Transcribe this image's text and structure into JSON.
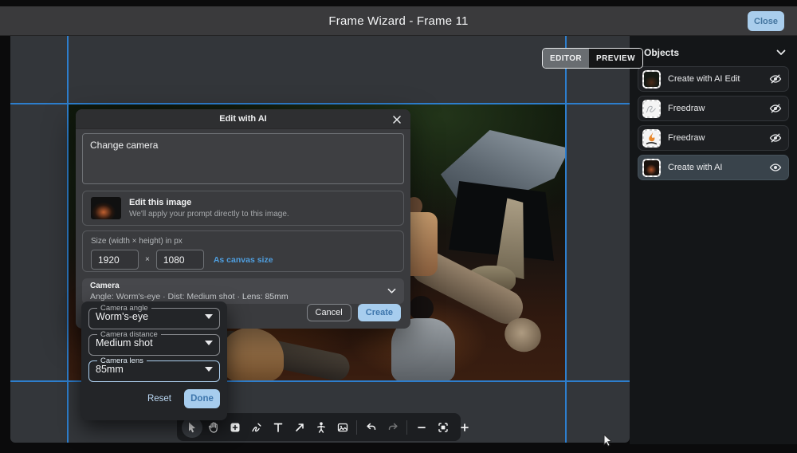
{
  "window": {
    "title": "Frame Wizard - Frame 11",
    "close_label": "Close"
  },
  "view_toggle": {
    "editor": "EDITOR",
    "preview": "PREVIEW"
  },
  "objects_panel": {
    "title": "Objects",
    "items": [
      {
        "label": "Create with AI Edit",
        "visible": false,
        "thumb": "dark-photo"
      },
      {
        "label": "Freedraw",
        "visible": false,
        "thumb": "gray-scribble"
      },
      {
        "label": "Freedraw",
        "visible": false,
        "thumb": "flame-sketch"
      },
      {
        "label": "Create with AI",
        "visible": true,
        "selected": true,
        "thumb": "dark-photo-fire"
      }
    ]
  },
  "modal": {
    "title": "Edit with AI",
    "prompt_value": "Change camera",
    "edit_target": {
      "title": "Edit this image",
      "description": "We'll apply your prompt directly to this image."
    },
    "size": {
      "label": "Size (width × height) in px",
      "width_value": "1920",
      "times": "×",
      "height_value": "1080",
      "canvas_link": "As canvas size"
    },
    "camera_summary": {
      "title": "Camera",
      "subtitle": "Angle: Worm's-eye · Dist: Medium shot · Lens: 85mm"
    },
    "cancel_label": "Cancel",
    "create_label": "Create"
  },
  "camera_popover": {
    "fields": [
      {
        "label": "Camera angle",
        "value": "Worm's-eye",
        "focused": false
      },
      {
        "label": "Camera distance",
        "value": "Medium shot",
        "focused": false
      },
      {
        "label": "Camera lens",
        "value": "85mm",
        "focused": true
      }
    ],
    "reset_label": "Reset",
    "done_label": "Done"
  },
  "toolbar": {
    "tools": [
      "select",
      "hand",
      "add-shape",
      "freedraw",
      "text",
      "arrow",
      "character",
      "image",
      "undo",
      "redo",
      "zoom-out",
      "zoom-fit",
      "zoom-in"
    ],
    "active_tool": "select",
    "disabled_tools": [
      "redo"
    ]
  },
  "colors": {
    "guide_blue": "#2d7ecd",
    "accent_button": "#a7cdee",
    "accent_text": "#3e76ac",
    "link_blue": "#4f9fe0",
    "selected_layer_bg": "#39434b",
    "titlebar": "#3a3a3c",
    "canvas_bg": "#33363a",
    "sidebar_bg": "#141618",
    "modal_bg": "#3a3b3e",
    "popover_bg": "#232528"
  }
}
